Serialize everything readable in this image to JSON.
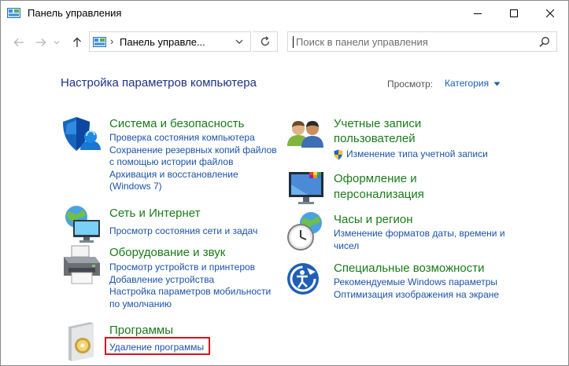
{
  "window": {
    "title": "Панель управления",
    "controls": [
      "minimize",
      "maximize",
      "close"
    ]
  },
  "address_bar": {
    "separator": "›",
    "location": "Панель управле...",
    "search_placeholder": "Поиск в панели управления"
  },
  "header": {
    "title": "Настройка параметров компьютера",
    "view_label": "Просмотр:",
    "view_value": "Категория"
  },
  "categories": {
    "system": {
      "title": "Система и безопасность",
      "icon": "shield-icon",
      "links": [
        "Проверка состояния компьютера",
        "Сохранение резервных копий файлов",
        "с помощью истории файлов",
        "Архивация и восстановление",
        "(Windows 7)"
      ]
    },
    "network": {
      "title": "Сеть и Интернет",
      "icon": "network-globe-icon",
      "links": [
        "Просмотр состояния сети и задач"
      ]
    },
    "hardware": {
      "title": "Оборудование и звук",
      "icon": "printer-icon",
      "links": [
        "Просмотр устройств и принтеров",
        "Добавление устройства",
        "Настройка параметров мобильности",
        "по умолчанию"
      ]
    },
    "programs": {
      "title": "Программы",
      "icon": "programs-disc-icon",
      "links": [
        "Удаление программы"
      ]
    },
    "accounts": {
      "title_line1": "Учетные записи",
      "title_line2": "пользователей",
      "icon": "users-icon",
      "links": [
        "Изменение типа учетной записи"
      ]
    },
    "appearance": {
      "title_line1": "Оформление и",
      "title_line2": "персонализация",
      "icon": "monitor-palette-icon",
      "links": []
    },
    "clock": {
      "title": "Часы и регион",
      "icon": "clock-globe-icon",
      "links": [
        "Изменение форматов даты, времени и",
        "чисел"
      ]
    },
    "access": {
      "title": "Специальные возможности",
      "icon": "ease-of-access-icon",
      "links": [
        "Рекомендуемые Windows параметры",
        "Оптимизация изображения на экране"
      ]
    }
  },
  "colors": {
    "category_title": "#1a7a1a",
    "link": "#1a52a8",
    "heading": "#1e3287",
    "highlight_border": "#d8141c"
  }
}
